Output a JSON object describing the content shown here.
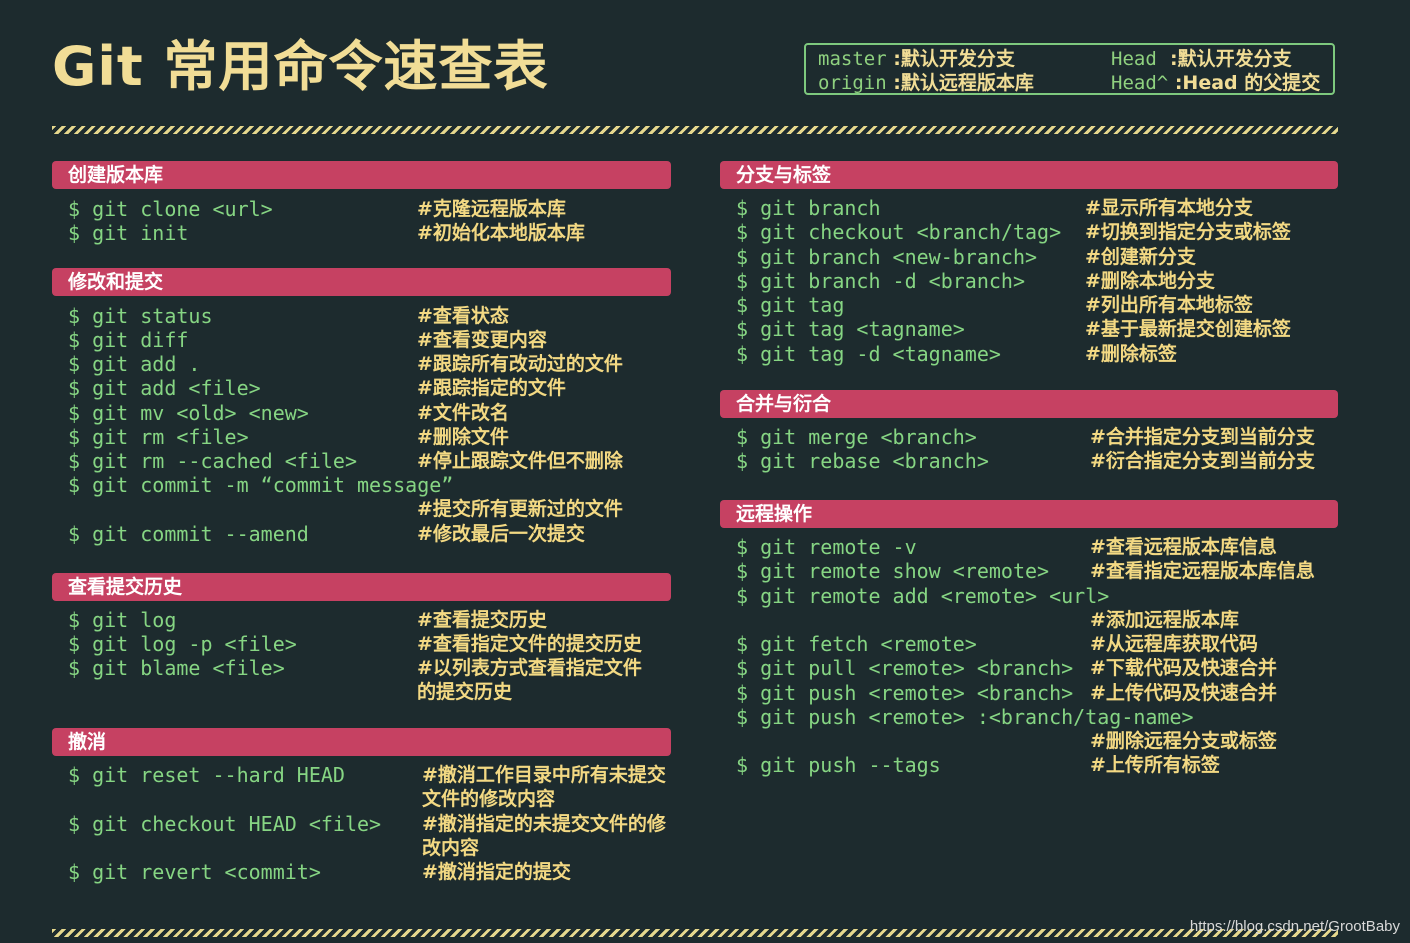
{
  "title": "Git 常用命令速查表",
  "legend": {
    "items": [
      {
        "key": "master",
        "desc": "默认开发分支"
      },
      {
        "key": "origin",
        "desc": "默认远程版本库"
      },
      {
        "key": "Head",
        "desc": "默认开发分支"
      },
      {
        "key": "Head^",
        "desc": "Head 的父提交"
      }
    ]
  },
  "sections": {
    "create": {
      "title": "创建版本库",
      "cmds": [
        "$ git clone <url>",
        "$ git init"
      ],
      "comments": [
        "#克隆远程版本库",
        "#初始化本地版本库"
      ]
    },
    "modify": {
      "title": "修改和提交",
      "cmds": [
        "$ git status",
        "$ git diff",
        "$ git add .",
        "$ git add <file>",
        "$ git mv <old> <new>",
        "$ git rm <file>",
        "$ git rm --cached <file>",
        "$ git commit -m “commit message”",
        "$ git commit --amend"
      ],
      "comments": [
        "#查看状态",
        "#查看变更内容",
        "#跟踪所有改动过的文件",
        "#跟踪指定的文件",
        "#文件改名",
        "#删除文件",
        "#停止跟踪文件但不删除",
        "#提交所有更新过的文件",
        "#修改最后一次提交"
      ]
    },
    "history": {
      "title": "查看提交历史",
      "cmds": [
        "$ git log",
        "$ git log -p <file>",
        "$ git blame <file>"
      ],
      "comments": [
        "#查看提交历史",
        "#查看指定文件的提交历史",
        "#以列表方式查看指定文件",
        "的提交历史"
      ]
    },
    "undo": {
      "title": "撤消",
      "cmds": [
        "$ git reset --hard HEAD",
        "$ git checkout HEAD <file>",
        "$ git revert <commit>"
      ],
      "comments": [
        "#撤消工作目录中所有未提交",
        "文件的修改内容",
        "#撤消指定的未提交文件的修",
        "改内容",
        "#撤消指定的提交"
      ]
    },
    "branch": {
      "title": "分支与标签",
      "cmds": [
        "$ git branch",
        "$ git checkout <branch/tag>",
        "$ git branch <new-branch>",
        "$ git branch -d <branch>",
        "$ git tag",
        "$ git tag <tagname>",
        "$ git tag -d <tagname>"
      ],
      "comments": [
        "#显示所有本地分支",
        "#切换到指定分支或标签",
        "#创建新分支",
        "#删除本地分支",
        "#列出所有本地标签",
        "#基于最新提交创建标签",
        "#删除标签"
      ]
    },
    "merge": {
      "title": "合并与衍合",
      "cmds": [
        "$ git merge <branch>",
        "$ git rebase <branch>"
      ],
      "comments": [
        "#合并指定分支到当前分支",
        "#衍合指定分支到当前分支"
      ]
    },
    "remote": {
      "title": "远程操作",
      "cmds": [
        "$ git remote -v",
        "$ git remote show <remote>",
        "$ git remote add <remote> <url>",
        "$ git fetch <remote>",
        "$ git pull <remote> <branch>",
        "$ git push <remote> <branch>",
        "$ git push <remote> :<branch/tag-name>",
        "$ git push --tags"
      ],
      "comments": [
        "#查看远程版本库信息",
        "#查看指定远程版本库信息",
        "#添加远程版本库",
        "#从远程库获取代码",
        "#下载代码及快速合并",
        "#上传代码及快速合并",
        "#删除远程分支或标签",
        "#上传所有标签"
      ]
    }
  },
  "watermark": "https://blog.csdn.net/GrootBaby"
}
